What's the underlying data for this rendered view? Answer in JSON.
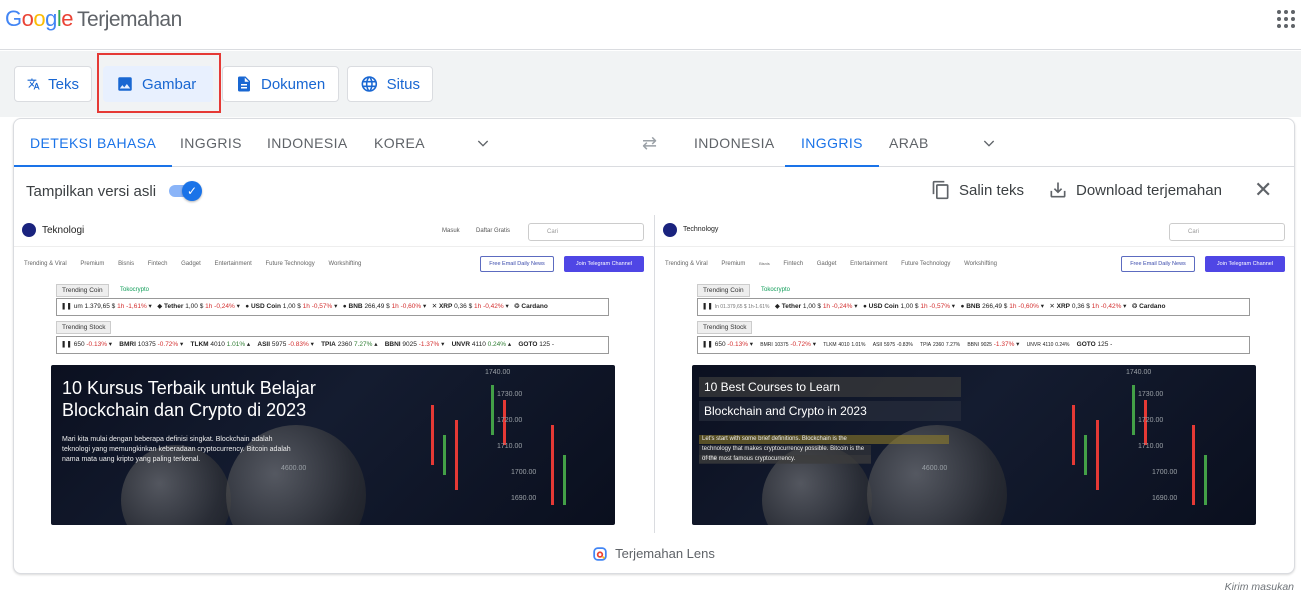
{
  "app": {
    "logo_text": "Google",
    "product": "Terjemahan"
  },
  "modes": [
    {
      "label": "Teks",
      "icon": "translate-icon"
    },
    {
      "label": "Gambar",
      "icon": "image-icon",
      "active": true
    },
    {
      "label": "Dokumen",
      "icon": "document-icon"
    },
    {
      "label": "Situs",
      "icon": "globe-icon"
    }
  ],
  "source_langs": [
    "DETEKSI BAHASA",
    "INGGRIS",
    "INDONESIA",
    "KOREA"
  ],
  "target_langs": [
    "INDONESIA",
    "INGGRIS",
    "ARAB"
  ],
  "toolbar": {
    "show_original": "Tampilkan versi asli",
    "show_original_on": true,
    "copy": "Salin teks",
    "download": "Download terjemahan"
  },
  "left": {
    "site_title": "Teknologi",
    "login": "Masuk",
    "signup": "Daftar Gratis",
    "search_placeholder": "Cari",
    "nav": [
      "Trending & Viral",
      "Premium",
      "Bisnis",
      "Fintech",
      "Gadget",
      "Entertainment",
      "Future Technology",
      "Workshifting"
    ],
    "free_email": "Free Email Daily News",
    "telegram": "Join Telegram Channel",
    "trending_coin": "Trending Coin",
    "tokocrypto": "Tokocrypto",
    "coin_ticker": {
      "lead": "um 1.379,65 $",
      "lead_change": "1h -1,61%",
      "items": [
        {
          "name": "Tether",
          "price": "1,00 $",
          "change": "1h -0,24%"
        },
        {
          "name": "USD Coin",
          "price": "1,00 $",
          "change": "1h -0,57%"
        },
        {
          "name": "BNB",
          "price": "266,49 $",
          "change": "1h -0,60%"
        },
        {
          "name": "XRP",
          "price": "0,36 $",
          "change": "1h -0,42%"
        },
        {
          "name": "Cardano",
          "price": "",
          "change": ""
        }
      ]
    },
    "trending_stock": "Trending Stock",
    "stock_ticker": {
      "lead": "650",
      "lead_change": "-0.13%",
      "items": [
        {
          "name": "BMRI",
          "price": "10375",
          "change": "-0.72%"
        },
        {
          "name": "TLKM",
          "price": "4010",
          "change": "1.01%"
        },
        {
          "name": "ASII",
          "price": "5975",
          "change": "-0.83%"
        },
        {
          "name": "TPIA",
          "price": "2360",
          "change": "7.27%"
        },
        {
          "name": "BBNI",
          "price": "9025",
          "change": "-1.37%"
        },
        {
          "name": "UNVR",
          "price": "4110",
          "change": "0.24%"
        },
        {
          "name": "GOTO",
          "price": "125",
          "change": "-"
        }
      ]
    },
    "hero_title_1": "10 Kursus Terbaik untuk Belajar",
    "hero_title_2": "Blockchain dan Crypto di 2023",
    "hero_desc_1": "Mari kita mulai dengan beberapa definisi singkat. Blockchain adalah",
    "hero_desc_2": "teknologi yang memungkinkan keberadaan cryptocurrency. Bitcoin adalah",
    "hero_desc_3": "nama mata uang kripto yang paling terkenal."
  },
  "right": {
    "site_title": "Technology",
    "search_placeholder": "Cari",
    "nav": [
      "Trending & Viral",
      "Premium",
      "Bisnis",
      "Fintech",
      "Gadget",
      "Entertainment",
      "Future Technology",
      "Workshifting"
    ],
    "free_email": "Free Email Daily News",
    "telegram": "Join Telegram Channel",
    "trending_coin": "Trending Coin",
    "tokocrypto": "Tokocrypto",
    "coin_ticker": {
      "lead": "In 01.379,65 $ 1h-1.61%",
      "items": [
        {
          "name": "Tether",
          "price": "1,00 $",
          "change": "1h -0,24%"
        },
        {
          "name": "USD Coin",
          "price": "1,00 $",
          "change": "1h -0,57%"
        },
        {
          "name": "BNB",
          "price": "266,49 $",
          "change": "1h -0,60%"
        },
        {
          "name": "XRP",
          "price": "0,36 $",
          "change": "1h -0,42%"
        },
        {
          "name": "Cardano",
          "price": "",
          "change": ""
        }
      ]
    },
    "trending_stock": "Trending Stock",
    "stock_ticker": {
      "lead": "650",
      "lead_change": "-0.13%",
      "items": [
        {
          "name": "BMRI",
          "price": "10375",
          "change": "-0.72%"
        },
        {
          "name": "TLKM",
          "price": "4010",
          "change": "1.01%"
        },
        {
          "name": "ASII",
          "price": "5975",
          "change": "-0.83%"
        },
        {
          "name": "TPIA",
          "price": "2360",
          "change": "7.27%"
        },
        {
          "name": "BBNI",
          "price": "9025",
          "change": "-1.37%"
        },
        {
          "name": "UNVR",
          "price": "4110",
          "change": "0.24%"
        },
        {
          "name": "GOTO",
          "price": "125",
          "change": "-"
        }
      ]
    },
    "hero_title_1": "10 Best Courses to Learn",
    "hero_title_2": "Blockchain and Crypto in 2023",
    "hero_desc_1": "Let's start with some brief definitions. Blockchain is the",
    "hero_desc_2": "technology that makes cryptocurrency possible. Bitcoin is the name",
    "hero_desc_3": "of the most famous cryptocurrency."
  },
  "chart_axis": [
    "1740.00",
    "1730.00",
    "1720.00",
    "1710.00",
    "1700.00",
    "1690.00",
    "4600.00"
  ],
  "lens_label": "Terjemahan Lens",
  "feedback": "Kirim masukan"
}
